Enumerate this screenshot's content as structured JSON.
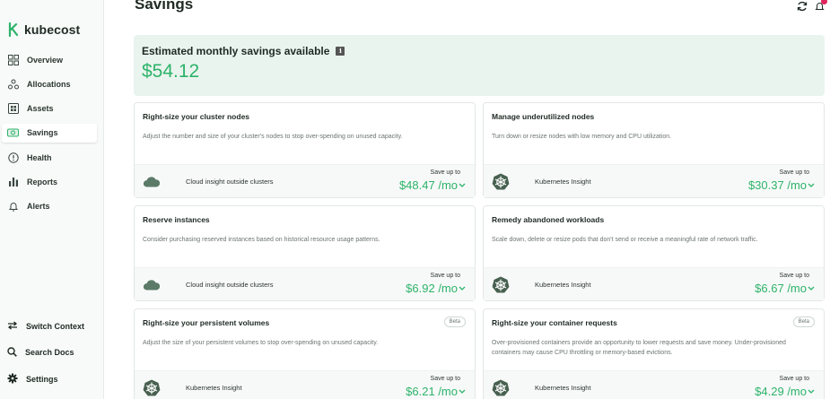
{
  "app": {
    "name": "kubecost"
  },
  "colors": {
    "accent": "#2db36a",
    "summary_bg": "#eaf4ee",
    "notification": "#e0245e"
  },
  "sidebar": {
    "items": [
      {
        "label": "Overview",
        "icon": "grid-icon"
      },
      {
        "label": "Allocations",
        "icon": "nodes-icon"
      },
      {
        "label": "Assets",
        "icon": "assets-icon"
      },
      {
        "label": "Savings",
        "icon": "savings-icon",
        "active": true
      },
      {
        "label": "Health",
        "icon": "health-icon"
      },
      {
        "label": "Reports",
        "icon": "bar-chart-icon"
      },
      {
        "label": "Alerts",
        "icon": "bell-icon"
      }
    ],
    "bottom": [
      {
        "label": "Switch Context",
        "icon": "switch-icon"
      },
      {
        "label": "Search Docs",
        "icon": "search-icon"
      },
      {
        "label": "Settings",
        "icon": "gear-icon"
      }
    ]
  },
  "header": {
    "title": "Savings"
  },
  "summary": {
    "title": "Estimated monthly savings available",
    "value": "$54.12"
  },
  "save_up_to_label": "Save up to",
  "cards": [
    {
      "title": "Right-size your cluster nodes",
      "description": "Adjust the number and size of your cluster's nodes to stop over-spending on unused capacity.",
      "insight": "Cloud insight outside clusters",
      "insight_icon": "cloud-icon",
      "value": "$48.47 /mo",
      "beta": ""
    },
    {
      "title": "Manage underutilized nodes",
      "description": "Turn down or resize nodes with low memory and CPU utilization.",
      "insight": "Kubernetes Insight",
      "insight_icon": "kubernetes-icon",
      "value": "$30.37 /mo",
      "beta": ""
    },
    {
      "title": "Reserve instances",
      "description": "Consider purchasing reserved instances based on historical resource usage patterns.",
      "insight": "Cloud insight outside clusters",
      "insight_icon": "cloud-icon",
      "value": "$6.92 /mo",
      "beta": ""
    },
    {
      "title": "Remedy abandoned workloads",
      "description": "Scale down, delete or resize pods that don't send or receive a meaningful rate of network traffic.",
      "insight": "Kubernetes Insight",
      "insight_icon": "kubernetes-icon",
      "value": "$6.67 /mo",
      "beta": ""
    },
    {
      "title": "Right-size your persistent volumes",
      "description": "Adjust the size of your persistent volumes to stop over-spending on unused capacity.",
      "insight": "Kubernetes Insight",
      "insight_icon": "kubernetes-icon",
      "value": "$6.21 /mo",
      "beta": "Beta"
    },
    {
      "title": "Right-size your container requests",
      "description": "Over-provisioned containers provide an opportunity to lower requests and save money. Under-provisioned containers may cause CPU throttling or memory-based evictions.",
      "insight": "Kubernetes Insight",
      "insight_icon": "kubernetes-icon",
      "value": "$4.29 /mo",
      "beta": "Beta"
    }
  ]
}
